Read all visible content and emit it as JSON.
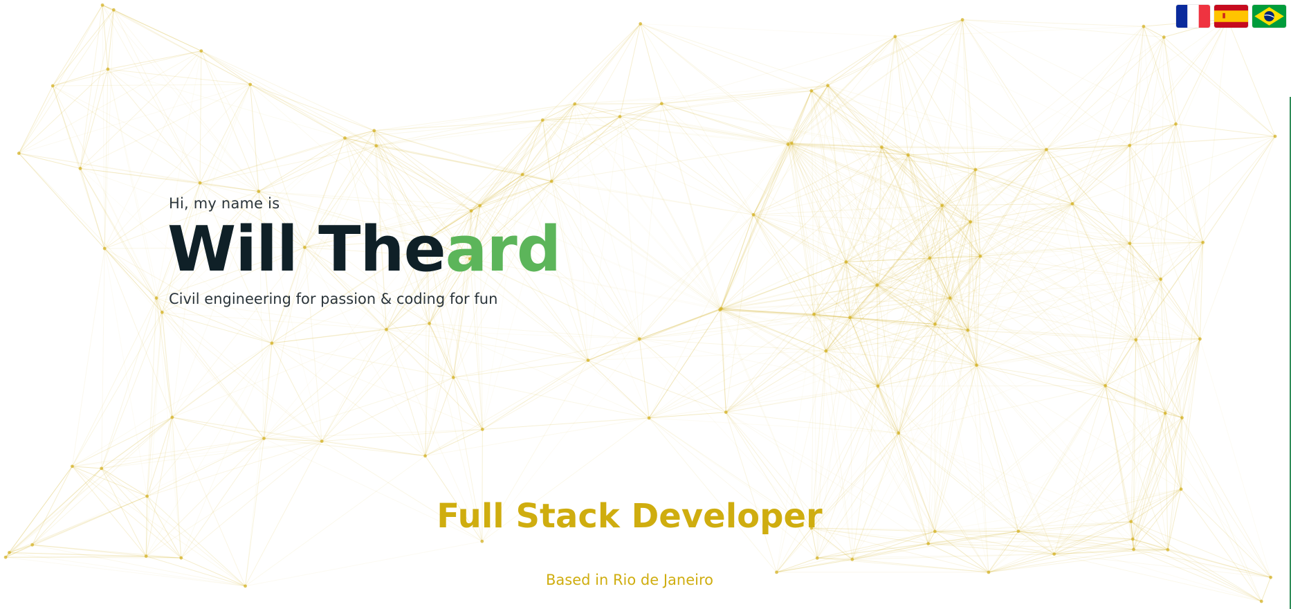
{
  "hero": {
    "greeting": "Hi, my name is",
    "name_part1": "Will The",
    "name_part2": "ard",
    "tagline": "Civil engineering for passion & coding for fun",
    "role": "Full Stack Developer",
    "location": "Based in Rio de Janeiro"
  },
  "languages": [
    {
      "name": "french-flag-icon"
    },
    {
      "name": "spanish-flag-icon"
    },
    {
      "name": "brazilian-flag-icon"
    }
  ],
  "colors": {
    "accent_green": "#5cb55a",
    "accent_gold": "#cfad0f",
    "network_node": "#d4b32a",
    "name_dark": "#0f2027"
  }
}
